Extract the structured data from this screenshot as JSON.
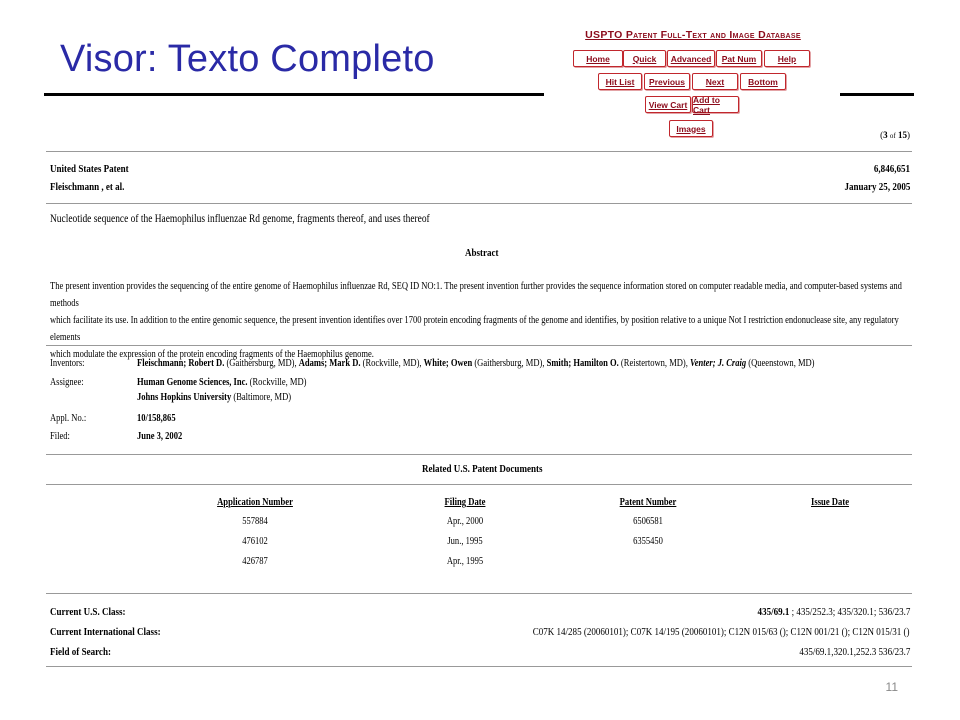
{
  "slide": {
    "title": "Visor: Texto Completo",
    "page_number": "11"
  },
  "uspto": {
    "db_title": "USPTO Patent Full-Text and Image Database",
    "nav": {
      "home": "Home",
      "quick": "Quick",
      "advanced": "Advanced",
      "pat_num": "Pat Num",
      "help": "Help",
      "hit_list": "Hit List",
      "previous": "Previous",
      "next": "Next",
      "bottom": "Bottom",
      "view_cart": "View Cart",
      "add_to_cart": "Add to Cart",
      "images": "Images"
    },
    "hits": {
      "open": "(",
      "current": "3",
      "of": "of",
      "total": "15",
      "close": ")"
    }
  },
  "patent": {
    "type_label": "United States Patent",
    "number": "6,846,651",
    "inventor_short": "Fleischmann , et al.",
    "date": "January 25, 2005",
    "title": "Nucleotide sequence of the Haemophilus influenzae Rd genome, fragments thereof, and uses thereof",
    "abstract_heading": "Abstract",
    "abstract_lines": [
      "The present invention provides the sequencing of the entire genome of Haemophilus influenzae Rd, SEQ ID NO:1. The present invention further provides the sequence information stored on computer readable media, and computer-based systems and methods",
      "which facilitate its use. In addition to the entire genomic sequence, the present invention identifies over 1700 protein encoding fragments of the genome and identifies, by position relative to a unique Not I restriction endonuclease site, any regulatory elements",
      "which modulate the expression of the protein encoding fragments of the Haemophilus genome."
    ],
    "inventors_label": "Inventors:",
    "inventors": [
      {
        "name": "Fleischmann; Robert D.",
        "loc": " (Gaithersburg, MD), "
      },
      {
        "name": "Adams; Mark D.",
        "loc": " (Rockville, MD), "
      },
      {
        "name": "White; Owen",
        "loc": " (Gaithersburg, MD), "
      },
      {
        "name": "Smith; Hamilton O.",
        "loc": " (Reistertown, MD), "
      },
      {
        "name": "Venter; J. Craig",
        "loc": " (Queenstown, MD)"
      }
    ],
    "assignee_label": "Assignee:",
    "assignees": [
      {
        "name": "Human Genome Sciences, Inc.",
        "loc": " (Rockville, MD)"
      },
      {
        "name": "Johns Hopkins University",
        "loc": " (Baltimore, MD)"
      }
    ],
    "appl_label": "Appl. No.:",
    "appl_no": "10/158,865",
    "filed_label": "Filed:",
    "filed": "June 3, 2002",
    "related_heading": "Related U.S. Patent Documents",
    "related_cols": [
      "Application Number",
      "Filing Date",
      "Patent Number",
      "Issue Date"
    ],
    "related_rows": [
      [
        "557884",
        "Apr., 2000",
        "6506581",
        ""
      ],
      [
        "476102",
        "Jun., 1995",
        "6355450",
        ""
      ],
      [
        "426787",
        "Apr., 1995",
        "",
        ""
      ]
    ],
    "us_class_label": "Current U.S. Class:",
    "us_class_main": "435/69.1",
    "us_class_rest": " ; 435/252.3; 435/320.1; 536/23.7",
    "intl_class_label": "Current International Class:",
    "intl_class": "C07K 14/285 (20060101); C07K 14/195 (20060101); C12N 015/63 (); C12N 001/21 (); C12N 015/31 ()",
    "field_label": "Field of Search:",
    "field": "435/69.1,320.1,252.3 536/23.7"
  }
}
